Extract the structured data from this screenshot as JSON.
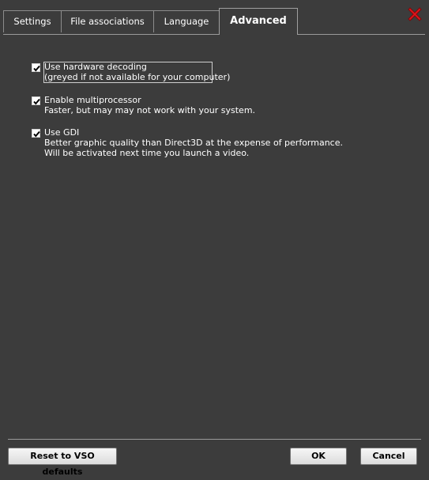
{
  "tabs": [
    {
      "label": "Settings",
      "active": false
    },
    {
      "label": "File associations",
      "active": false
    },
    {
      "label": "Language",
      "active": false
    },
    {
      "label": "Advanced",
      "active": true
    }
  ],
  "options": [
    {
      "checked": true,
      "label": "Use hardware decoding",
      "description": [
        "(greyed if not  available for your computer)"
      ]
    },
    {
      "checked": true,
      "label": "Enable multiprocessor",
      "description": [
        "Faster, but may may not work with your system."
      ]
    },
    {
      "checked": true,
      "label": "Use GDI",
      "description": [
        "Better graphic quality than Direct3D at the expense of performance.",
        "Will be activated next time you launch a video."
      ]
    }
  ],
  "buttons": {
    "reset": "Reset to VSO defaults",
    "ok": "OK",
    "cancel": "Cancel"
  },
  "colors": {
    "background": "#3c3c3c",
    "close_icon": "#e0151b"
  },
  "icons": {
    "close": "close-x-icon",
    "check": "checkmark-icon"
  }
}
